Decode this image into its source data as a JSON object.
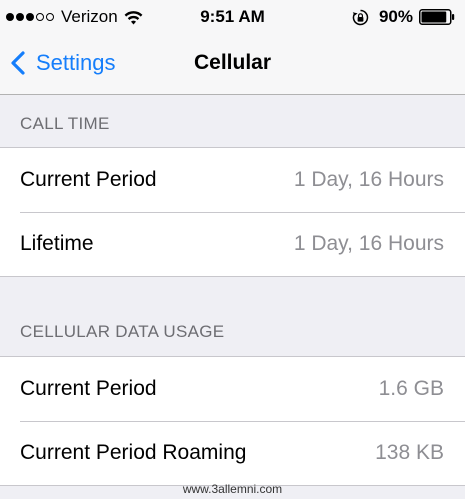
{
  "status_bar": {
    "signal_bars_filled": 3,
    "signal_bars_total": 5,
    "carrier": "Verizon",
    "time": "9:51 AM",
    "battery_percent": "90%",
    "battery_level": 0.9,
    "icons": [
      "wifi-icon",
      "rotation-lock-icon",
      "battery-icon"
    ]
  },
  "nav": {
    "back_label": "Settings",
    "title": "Cellular",
    "accent_color": "#157efb"
  },
  "sections": [
    {
      "header": "CALL TIME",
      "rows": [
        {
          "label": "Current Period",
          "value": "1 Day, 16 Hours"
        },
        {
          "label": "Lifetime",
          "value": "1 Day, 16 Hours"
        }
      ]
    },
    {
      "header": "CELLULAR DATA USAGE",
      "rows": [
        {
          "label": "Current Period",
          "value": "1.6 GB"
        },
        {
          "label": "Current Period Roaming",
          "value": "138 KB"
        }
      ]
    }
  ],
  "watermark": "www.3allemni.com"
}
